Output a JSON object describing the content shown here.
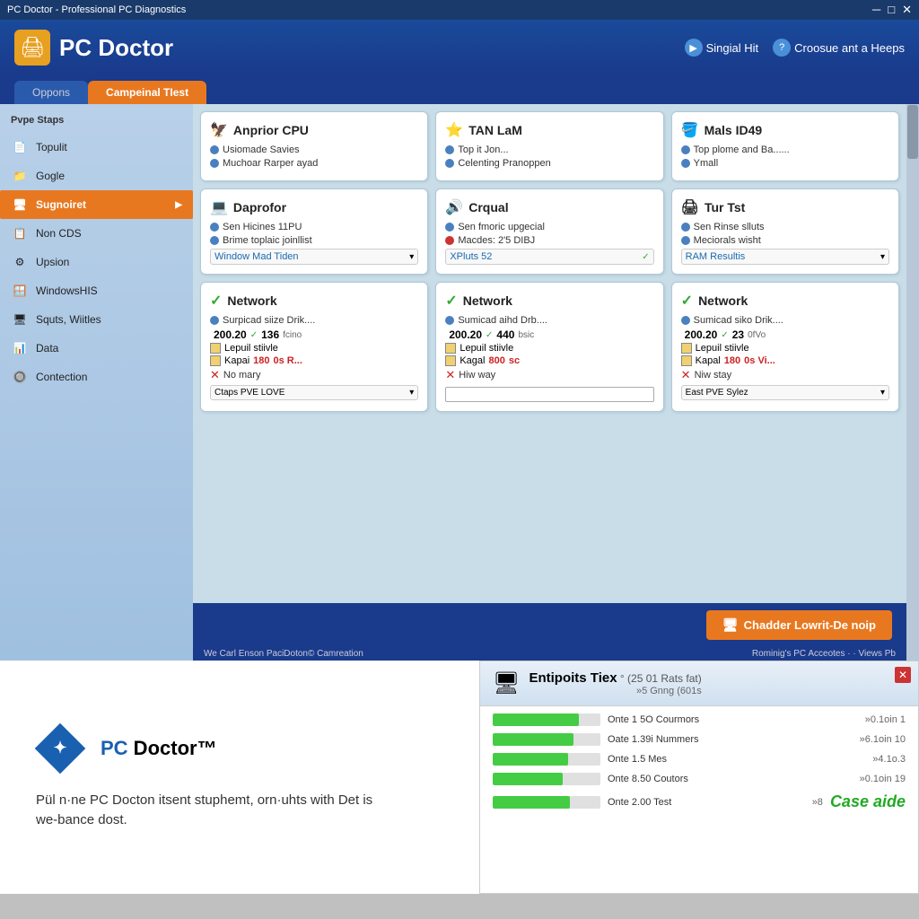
{
  "titleBar": {
    "text": "PC Doctor - Professional PC Diagnostics",
    "controls": [
      "─",
      "□",
      "✕"
    ]
  },
  "header": {
    "logoIcon": "🖨",
    "appName": "PC Doctor",
    "singialHit": "Singial Hit",
    "croosue": "Croosue ant a Heeps"
  },
  "tabs": [
    {
      "label": "Oppons",
      "active": false
    },
    {
      "label": "Campeinal TIest",
      "active": true
    }
  ],
  "sidebar": {
    "title": "Pvpe Staps",
    "items": [
      {
        "label": "Topulit",
        "icon": "📄",
        "active": false
      },
      {
        "label": "Gogle",
        "icon": "📁",
        "active": false
      },
      {
        "label": "Sugnoiret",
        "icon": "🖥",
        "active": true
      },
      {
        "label": "Non CDS",
        "icon": "📋",
        "active": false
      },
      {
        "label": "Upsion",
        "icon": "⚙",
        "active": false
      },
      {
        "label": "WindowsHIS",
        "icon": "🪟",
        "active": false
      },
      {
        "label": "Squts, Wiitles",
        "icon": "🖥",
        "active": false
      },
      {
        "label": "Data",
        "icon": "📊",
        "active": false
      },
      {
        "label": "Contection",
        "icon": "🔘",
        "active": false
      }
    ]
  },
  "cards": [
    {
      "id": "card1",
      "icon": "🦅",
      "title": "Anprior CPU",
      "rows": [
        {
          "dot": "blue",
          "text": "Usiomade Savies"
        },
        {
          "dot": "blue",
          "text": "Muchoar Rarper ayad"
        }
      ]
    },
    {
      "id": "card2",
      "icon": "⭐",
      "title": "TAN LaM",
      "rows": [
        {
          "dot": "blue",
          "text": "Top it Jon..."
        },
        {
          "dot": "blue",
          "text": "Celenting Pranoppen"
        }
      ]
    },
    {
      "id": "card3",
      "icon": "🪣",
      "title": "Mals ID49",
      "rows": [
        {
          "dot": "blue",
          "text": "Top plome and Ba......"
        },
        {
          "dot": "blue",
          "text": "Ymall"
        }
      ]
    },
    {
      "id": "card4",
      "icon": "💻",
      "title": "Daprofor",
      "rows": [
        {
          "dot": "blue",
          "text": "Sen Hicines 11PU"
        },
        {
          "dot": "blue",
          "text": "Brime toplaic joinllist"
        }
      ],
      "link": "Window Mad Tiden",
      "hasDropdown": true
    },
    {
      "id": "card5",
      "icon": "🔊",
      "title": "Crqual",
      "rows": [
        {
          "dot": "blue",
          "text": "Sen fmoric upgecial"
        },
        {
          "dot": "red",
          "text": "Macdes: 2'5 DIBJ"
        }
      ],
      "link": "XPluts 52",
      "hasCheckGreen": true
    },
    {
      "id": "card6",
      "icon": "🖨",
      "title": "Tur Tst",
      "rows": [
        {
          "dot": "blue",
          "text": "Sen Rinse slluts"
        },
        {
          "dot": "blue",
          "text": "Meciorals wisht"
        }
      ],
      "link": "RAM Resultis",
      "hasDropdown": true
    },
    {
      "id": "net1",
      "type": "network",
      "title": "Network",
      "desc1": "Surpicad siize Drik....",
      "metric1": "200.20",
      "metric2": "136",
      "metric2unit": "fcino",
      "checkbox1": "Lepuil stiivle",
      "boldLabel": "Kapai",
      "boldVal": "180",
      "boldSuffix": "0s R...",
      "errorLabel": "No mary",
      "bottomLabel": "Ctaps PVE LOVE"
    },
    {
      "id": "net2",
      "type": "network",
      "title": "Network",
      "desc1": "Sumicad aihd Drb....",
      "metric1": "200.20",
      "metric2": "440",
      "metric2unit": "bsic",
      "checkbox1": "Lepuil stiivle",
      "boldLabel": "Kagal",
      "boldVal": "800",
      "boldSuffix": "sc",
      "errorLabel": "Hiw way",
      "hasInput": true
    },
    {
      "id": "net3",
      "type": "network",
      "title": "Network",
      "desc1": "Sumicad siko Drik....",
      "metric1": "200.20",
      "metric2": "23",
      "metric2unit": "0fVo",
      "checkbox1": "Lepuil stiivle",
      "boldLabel": "Kapal",
      "boldVal": "180",
      "boldSuffix": "0s Vi...",
      "errorLabel": "Niw stay",
      "bottomLabel": "East PVE Sylez"
    }
  ],
  "actionButton": {
    "label": "Chadder Lowrit-De noip"
  },
  "statusBar": {
    "left": "We Carl Enson PaciDoton© Camreation",
    "right": "Rominig's PC Acceotes · · Views Pb"
  },
  "lowerLeft": {
    "logoText1": "PC",
    "logoText2": "Doctor",
    "desc": "Pül n·ne PC Docton itsent stuphemt,\norn·uhts with Det is we-bance dost."
  },
  "lowerRight": {
    "title": "Entipoits Tiex",
    "titleSuffix": "° (25 01 Rats fat)",
    "subtitle": "»5 Gnng (601s",
    "closeBtn": "✕",
    "progressItems": [
      {
        "label": "Onte 1 5O Courmors",
        "pct": 80,
        "value": "»0.1oin 1"
      },
      {
        "label": "Oate 1.39i Nummers",
        "pct": 75,
        "value": "»6.1oin 10"
      },
      {
        "label": "Onte 1.5 Mes",
        "pct": 70,
        "value": "»4.1o.3"
      },
      {
        "label": "Onte 8.50 Coutors",
        "pct": 65,
        "value": "»0.1oin 19"
      },
      {
        "label": "Onte 2.00 Test",
        "pct": 72,
        "value": "»8"
      }
    ],
    "caseBadge": "Case aide"
  }
}
